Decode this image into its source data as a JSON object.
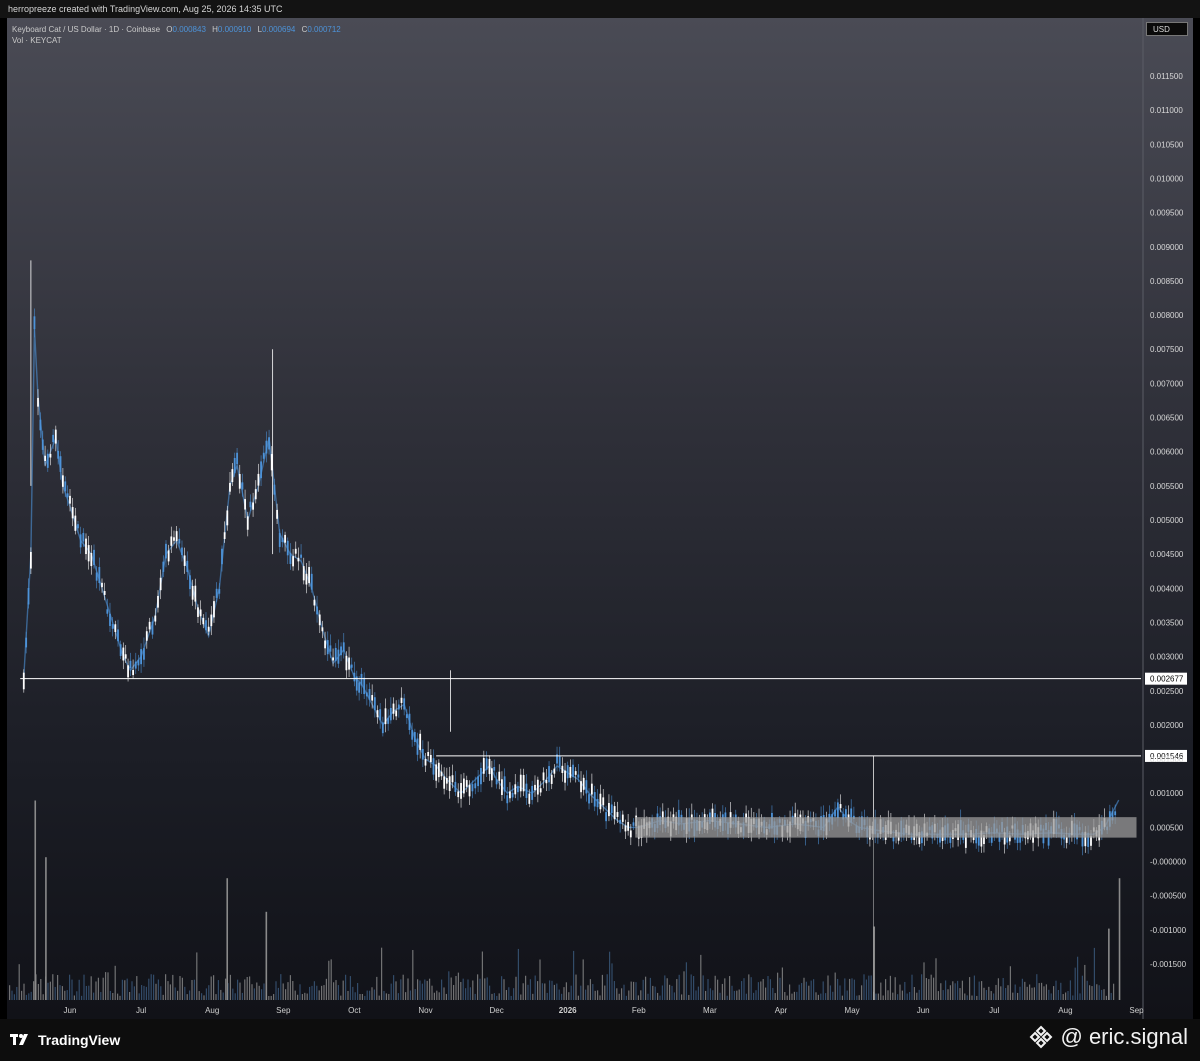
{
  "header": {
    "credit": "herropreeze created with TradingView.com, Aug 25, 2026 14:35 UTC"
  },
  "legend": {
    "symbol_line": "Keyboard Cat / US Dollar · 1D · Coinbase",
    "o_label": "O",
    "o_value": "0.000843",
    "h_label": "H",
    "h_value": "0.000910",
    "l_label": "L",
    "l_value": "0.000694",
    "c_label": "C",
    "c_value": "0.000712",
    "volume_line": "Vol · KEYCAT"
  },
  "currency_button": "USD",
  "footer": {
    "logo_text": "TradingView",
    "watermark_text": "@ eric.signal"
  },
  "colors": {
    "candle": "#4d93d9",
    "volume": "#8a8a8a",
    "level_line": "#ffffff",
    "range_box": "#9a9a9a"
  },
  "icons": {
    "tv_logo": "tradingview-logo-icon",
    "binance": "binance-diamond-icon"
  },
  "chart_data": {
    "type": "line",
    "title": "Keyboard Cat / US Dollar · 1D · Coinbase",
    "y_ticks": [
      "0.011500",
      "0.011000",
      "0.010500",
      "0.010000",
      "0.009500",
      "0.009000",
      "0.008500",
      "0.008000",
      "0.007500",
      "0.007000",
      "0.006500",
      "0.006000",
      "0.005500",
      "0.005000",
      "0.004500",
      "0.004000",
      "0.003500",
      "0.003000",
      "0.002500",
      "0.002000",
      "0.001500",
      "0.001000",
      "0.000500",
      "-0.000000",
      "-0.000500",
      "-0.001000",
      "-0.001500"
    ],
    "y_tick_values": [
      0.0115,
      0.011,
      0.0105,
      0.01,
      0.0095,
      0.009,
      0.0085,
      0.008,
      0.0075,
      0.007,
      0.0065,
      0.006,
      0.0055,
      0.005,
      0.0045,
      0.004,
      0.0035,
      0.003,
      0.0025,
      0.002,
      0.0015,
      0.001,
      0.0005,
      0,
      -0.0005,
      -0.001,
      -0.0015
    ],
    "x_ticks": [
      "Jun",
      "Jul",
      "Aug",
      "Sep",
      "Oct",
      "Nov",
      "Dec",
      "2026",
      "Feb",
      "Mar",
      "Apr",
      "May",
      "Jun",
      "Jul",
      "Aug",
      "Sep"
    ],
    "x_tick_positions_index": [
      0,
      1,
      2,
      3,
      4,
      5,
      6,
      7,
      8,
      9,
      10,
      11,
      12,
      13,
      14,
      15
    ],
    "ylim": [
      -0.0019,
      0.0122
    ],
    "series": [
      {
        "x_month_index": [
          -0.65,
          -0.55,
          -0.5,
          -0.45,
          -0.35,
          -0.2,
          -0.1,
          0.0,
          0.15,
          0.3,
          0.45,
          0.6,
          0.75,
          0.85,
          1.0,
          1.2,
          1.35,
          1.5,
          1.65,
          1.8,
          1.95,
          2.1,
          2.25,
          2.35,
          2.5,
          2.65,
          2.8,
          2.95,
          3.1,
          3.25,
          3.4,
          3.55,
          3.7,
          3.85,
          4.0,
          4.1,
          4.25,
          4.4,
          4.55,
          4.7,
          4.85,
          5.0,
          5.15,
          5.3,
          5.5,
          5.7,
          5.9,
          6.0,
          6.15,
          6.3,
          6.5,
          6.7,
          6.85,
          7.0,
          7.15,
          7.3,
          7.5,
          7.7,
          7.85,
          8.0,
          8.3,
          8.6,
          9.0,
          9.4,
          9.8,
          10.2,
          10.6,
          10.8,
          10.95,
          11.1,
          11.4,
          11.8,
          12.2,
          12.6,
          13.0,
          13.4,
          13.8,
          14.2,
          14.4,
          14.55,
          14.7,
          14.75
        ],
        "values": [
          0.0027,
          0.0045,
          0.0078,
          0.0068,
          0.0058,
          0.0062,
          0.0055,
          0.0052,
          0.0047,
          0.0045,
          0.004,
          0.0035,
          0.003,
          0.0028,
          0.003,
          0.0036,
          0.0045,
          0.0047,
          0.0043,
          0.0037,
          0.0033,
          0.004,
          0.0055,
          0.0058,
          0.005,
          0.0055,
          0.0062,
          0.0048,
          0.0045,
          0.0044,
          0.004,
          0.0034,
          0.0029,
          0.0031,
          0.0027,
          0.0026,
          0.0023,
          0.002,
          0.0022,
          0.0023,
          0.0018,
          0.0015,
          0.0014,
          0.0012,
          0.001,
          0.0012,
          0.0014,
          0.0012,
          0.001,
          0.0011,
          0.001,
          0.0012,
          0.0014,
          0.0013,
          0.0012,
          0.001,
          0.0008,
          0.0006,
          0.0005,
          0.0005,
          0.0006,
          0.00055,
          0.0006,
          0.00055,
          0.0005,
          0.00055,
          0.0005,
          0.0008,
          0.0006,
          0.0005,
          0.00045,
          0.0004,
          0.0004,
          0.0004,
          0.00042,
          0.0004,
          0.00042,
          0.0004,
          0.0004,
          0.0005,
          0.0008,
          0.0009
        ]
      }
    ],
    "levels": [
      {
        "label": "0.002677",
        "value": 0.002677,
        "start_month_index": -0.7
      },
      {
        "label": "0.001546",
        "value": 0.001546,
        "start_month_index": 5.15
      }
    ],
    "range_box": {
      "low": 0.00035,
      "high": 0.00065,
      "start_month_index": 7.95,
      "end_month_index": 15.0
    },
    "volume_spikes": [
      {
        "month_index": -0.5,
        "relative": 0.95
      },
      {
        "month_index": -0.35,
        "relative": 0.68
      },
      {
        "month_index": 2.2,
        "relative": 0.58
      },
      {
        "month_index": 2.75,
        "relative": 0.42
      },
      {
        "month_index": 11.3,
        "relative": 0.35
      },
      {
        "month_index": 14.75,
        "relative": 0.58
      },
      {
        "month_index": 14.6,
        "relative": 0.34
      }
    ],
    "grid": false,
    "legend_position": "top-left"
  }
}
